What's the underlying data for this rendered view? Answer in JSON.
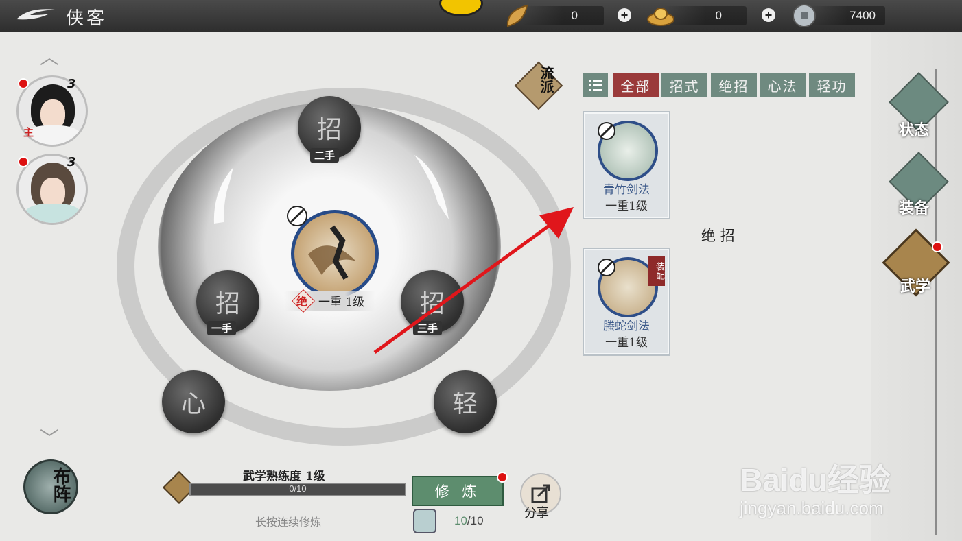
{
  "topbar": {
    "title": "侠客",
    "currencies": [
      {
        "icon": "gold-leaf-icon",
        "value": "0"
      },
      {
        "icon": "gold-ingot-icon",
        "value": "0"
      },
      {
        "icon": "copper-coin-icon",
        "value": "7400"
      }
    ]
  },
  "party": {
    "members": [
      {
        "level": "3",
        "tag": "主"
      },
      {
        "level": "3"
      }
    ]
  },
  "formation_button": "布阵",
  "wheel": {
    "center_level": "一重 1级",
    "center_badge": "绝",
    "slots": [
      {
        "glyph": "招",
        "caption": "二手"
      },
      {
        "glyph": "招",
        "caption": "一手"
      },
      {
        "glyph": "招",
        "caption": "三手"
      },
      {
        "glyph": "心"
      },
      {
        "glyph": "轻"
      }
    ]
  },
  "school_label": "流派",
  "filter_tabs": [
    "全部",
    "招式",
    "绝招",
    "心法",
    "轻功"
  ],
  "active_tab": "全部",
  "skills_top": [
    {
      "name": "青竹剑法",
      "level": "一重1级"
    }
  ],
  "section_header": "绝 招",
  "skills_ultimate": [
    {
      "name": "螣蛇剑法",
      "level": "一重1级",
      "tag": "装配"
    }
  ],
  "right_nav": [
    "状态",
    "装备",
    "武学"
  ],
  "active_nav": "武学",
  "training": {
    "title": "武学熟练度 1级",
    "progress_text": "0/10",
    "progress_fraction": 0.0,
    "hint": "长按连续修炼",
    "train_button": "修 炼",
    "share_label": "分享",
    "book_current": "10",
    "book_max": "/10"
  },
  "watermark": {
    "brand": "Baidu经验",
    "url": "jingyan.baidu.com"
  },
  "colors": {
    "accent_red": "#9a3a3a",
    "tab_green": "#6f8a80",
    "train_green": "#5d8d6e"
  }
}
